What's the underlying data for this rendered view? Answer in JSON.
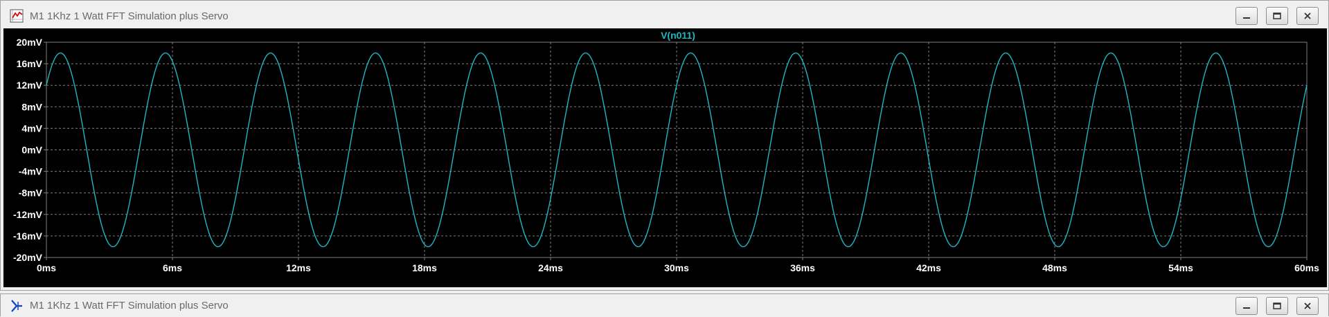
{
  "windows": [
    {
      "title": "M1 1Khz 1 Watt FFT Simulation plus Servo",
      "icon": "waveform-plot-icon"
    },
    {
      "title": "M1 1Khz 1 Watt FFT Simulation plus Servo",
      "icon": "schematic-icon"
    }
  ],
  "colors": {
    "trace": "#1fb8c2",
    "plot_bg": "#000000",
    "grid": "#808080",
    "label": "#ffffff"
  },
  "chart_data": {
    "type": "line",
    "title": "V(n011)",
    "xlabel": "",
    "ylabel": "",
    "xlim": [
      0,
      60
    ],
    "ylim": [
      -20,
      20
    ],
    "x_ticks": [
      0,
      6,
      12,
      18,
      24,
      30,
      36,
      42,
      48,
      54,
      60
    ],
    "x_tick_labels": [
      "0ms",
      "6ms",
      "12ms",
      "18ms",
      "24ms",
      "30ms",
      "36ms",
      "42ms",
      "48ms",
      "54ms",
      "60ms"
    ],
    "y_ticks": [
      20,
      16,
      12,
      8,
      4,
      0,
      -4,
      -8,
      -12,
      -16,
      -20
    ],
    "y_tick_labels": [
      "20mV",
      "16mV",
      "12mV",
      "8mV",
      "4mV",
      "0mV",
      "-4mV",
      "-8mV",
      "-12mV",
      "-16mV",
      "-20mV"
    ],
    "grid": true,
    "series": [
      {
        "name": "V(n011)",
        "amplitude_mV": 18,
        "period_ms": 5,
        "start_value_mV": 12,
        "end_value_mV": 12
      }
    ]
  }
}
